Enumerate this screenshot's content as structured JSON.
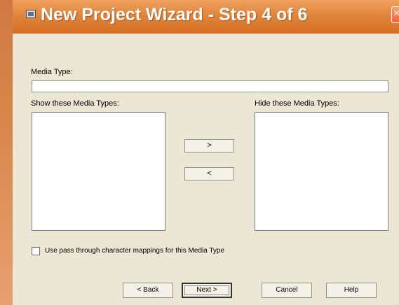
{
  "window": {
    "title": "New Project Wizard - Step 4 of 6",
    "close_symbol": "×",
    "icon": "window-icon"
  },
  "form": {
    "media_type_label": "Media Type:",
    "media_type_value": "",
    "show_label": "Show these Media Types:",
    "hide_label": "Hide these Media Types:",
    "move_right_label": ">",
    "move_left_label": "<",
    "checkbox_label": "Use pass through character mappings for this Media Type",
    "checkbox_checked": false
  },
  "footer": {
    "back_label": "< Back",
    "next_label": "Next >",
    "cancel_label": "Cancel",
    "help_label": "Help"
  },
  "colors": {
    "title_gradient_top": "#f0a15f",
    "title_gradient_bottom": "#d66f25",
    "dialog_background": "#ebe7d4",
    "input_border": "#8f8f8f"
  }
}
